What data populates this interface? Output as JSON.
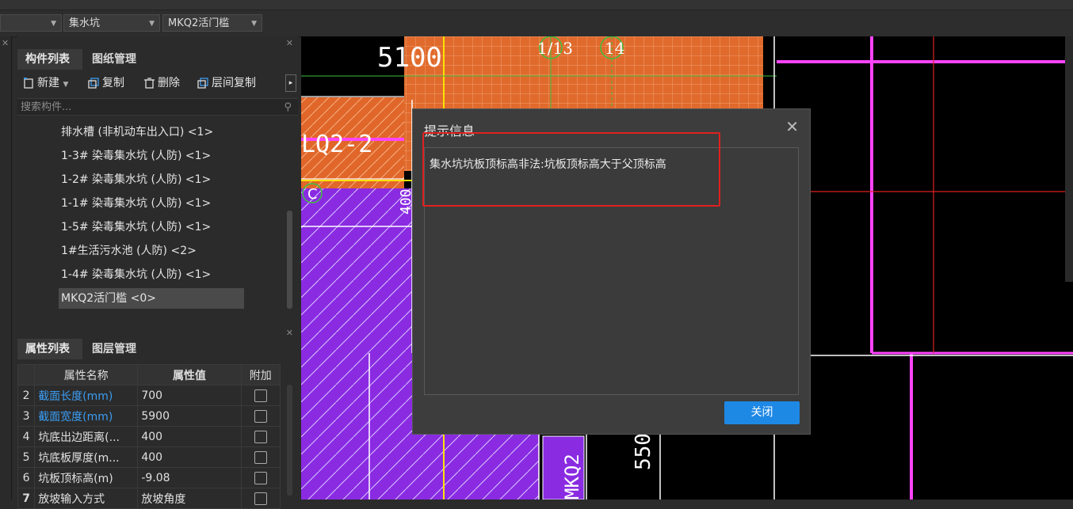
{
  "toolbar": {
    "combo1_value": "",
    "combo2_value": "集水坑",
    "combo3_value": "MKQ2活门槛"
  },
  "component_panel": {
    "tabs": [
      "构件列表",
      "图纸管理"
    ],
    "actions": {
      "new": "新建",
      "copy": "复制",
      "delete": "删除",
      "floor_copy": "层间复制"
    },
    "search_placeholder": "搜索构件...",
    "items": [
      "排水槽 (非机动车出入口) <1>",
      "1-3# 染毒集水坑 (人防) <1>",
      "1-2# 染毒集水坑 (人防) <1>",
      "1-1# 染毒集水坑 (人防) <1>",
      "1-5# 染毒集水坑 (人防) <1>",
      "1#生活污水池 (人防) <2>",
      "1-4# 染毒集水坑 (人防) <1>",
      "MKQ2活门槛 <0>"
    ]
  },
  "property_panel": {
    "tabs": [
      "属性列表",
      "图层管理"
    ],
    "headers": [
      "属性名称",
      "属性值",
      "附加"
    ],
    "rows": [
      {
        "num": "2",
        "name": "截面长度(mm)",
        "value": "700",
        "blue": true
      },
      {
        "num": "3",
        "name": "截面宽度(mm)",
        "value": "5900",
        "blue": true
      },
      {
        "num": "4",
        "name": "坑底出边距离(...",
        "value": "400",
        "blue": false
      },
      {
        "num": "5",
        "name": "坑底板厚度(m...",
        "value": "400",
        "blue": false
      },
      {
        "num": "6",
        "name": "坑板顶标高(m)",
        "value": "-9.08",
        "blue": false
      },
      {
        "num": "7",
        "name": "放坡输入方式",
        "value": "放坡角度",
        "blue": false
      }
    ]
  },
  "canvas": {
    "labels": {
      "dim_5100": "5100",
      "axis_1_13": "1/13",
      "axis_14": "14",
      "wall_label": "LQ2-2",
      "axis_c": "C",
      "dim_400": "400",
      "mkq2": "MKQ2",
      "dim_550": "550"
    }
  },
  "dialog": {
    "title": "提示信息",
    "message": "集水坑坑板顶标高非法:坑板顶标高大于父顶标高",
    "close_button": "关闭"
  },
  "colors": {
    "accent": "#1e88e5",
    "highlight": "#e02020",
    "orange": "#e0662a",
    "purple": "#8a2be2",
    "magenta": "#ff44ff"
  }
}
